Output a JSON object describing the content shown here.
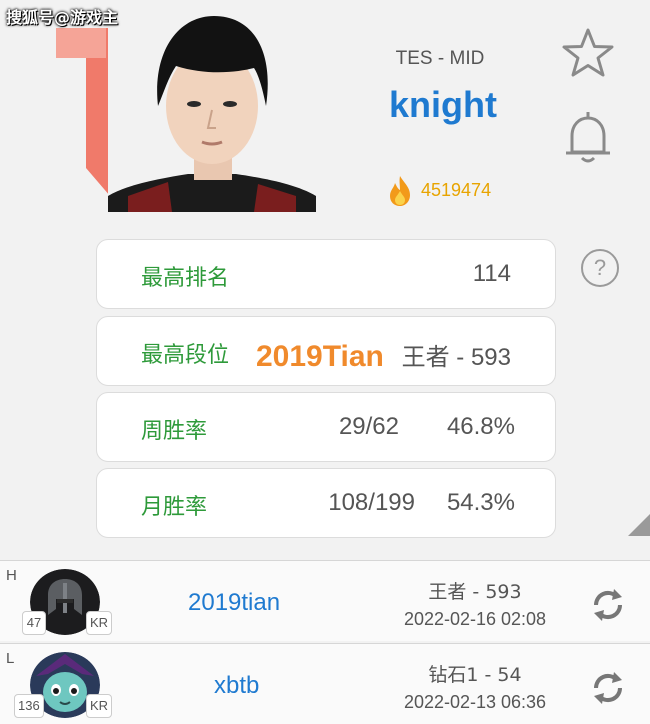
{
  "watermark": "搜狐号@游戏主",
  "profile": {
    "team_role": "TES - MID",
    "name": "knight",
    "popularity": "4519474"
  },
  "stats": [
    {
      "label": "最高排名",
      "value": "114"
    },
    {
      "label": "最高段位",
      "value": "王者 - 593"
    },
    {
      "label": "周胜率",
      "record": "29/62",
      "rate": "46.8%"
    },
    {
      "label": "月胜率",
      "record": "108/199",
      "rate": "54.3%"
    }
  ],
  "overlay_text": "2019Tian",
  "help_label": "?",
  "accounts": [
    {
      "tag": "H",
      "level": "47",
      "region": "KR",
      "name": "2019tian",
      "rank": "王者 - 593",
      "time": "2022-02-16 02:08"
    },
    {
      "tag": "L",
      "level": "136",
      "region": "KR",
      "name": "xbtb",
      "rank": "钻石1 - 54",
      "time": "2022-02-13 06:36"
    }
  ],
  "colors": {
    "accent_blue": "#1f7ad0",
    "label_green": "#2e9a3a",
    "popularity_gold": "#e8a400",
    "team_logo_red": "#f07a6a",
    "overlay_orange": "#f08a2c"
  },
  "icons": {
    "favorite": "star-outline-icon",
    "notify": "bell-outline-icon",
    "popularity": "fire-icon",
    "refresh": "refresh-icon",
    "help": "question-circle-icon"
  }
}
